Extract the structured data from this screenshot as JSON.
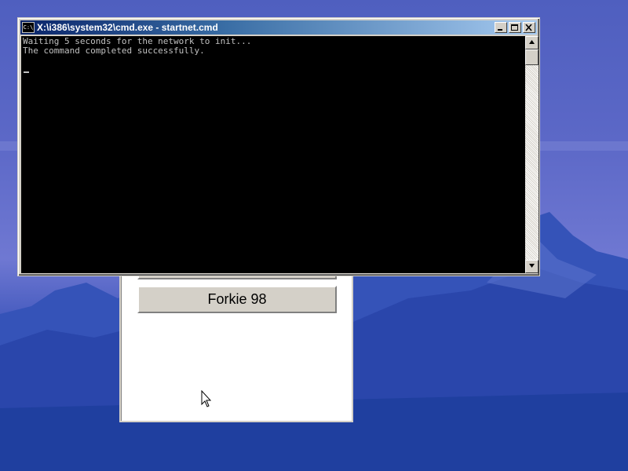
{
  "desktop": {
    "wallpaper": "mountain-lake-blue",
    "colors": {
      "sky": "#6f78d2",
      "mountain": "#2f4bb4"
    }
  },
  "launcher": {
    "buttons": [
      {
        "label": ""
      },
      {
        "label": "Forkie 98"
      }
    ]
  },
  "cmd_window": {
    "title": "X:\\i386\\system32\\cmd.exe - startnet.cmd",
    "icon": "console-icon",
    "icon_text": "C:\\",
    "lines": [
      "Waiting 5 seconds for the network to init...",
      "The command completed successfully."
    ],
    "colors": {
      "titlebar_start": "#0a246a",
      "titlebar_end": "#a6caf0",
      "console_bg": "#000000",
      "console_fg": "#c0c0c0"
    },
    "scrollbar": {
      "position": 0
    }
  }
}
